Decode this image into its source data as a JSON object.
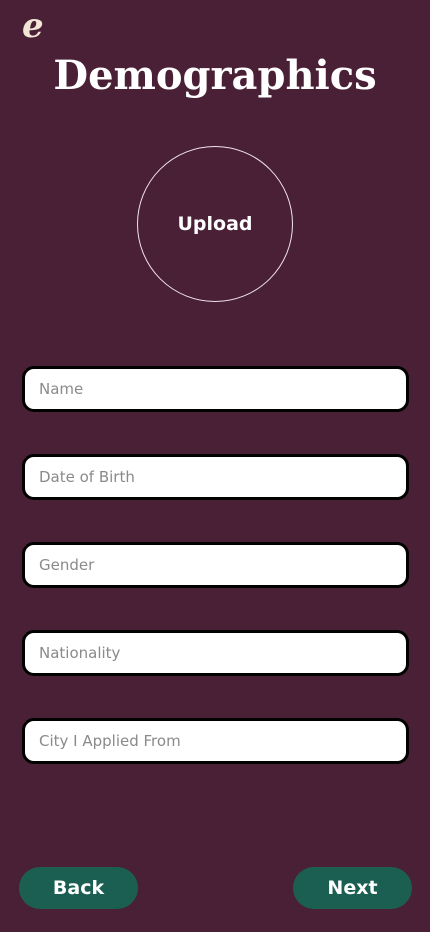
{
  "app": {
    "logo_text": "e"
  },
  "page": {
    "title": "Demographics"
  },
  "upload": {
    "label": "Upload"
  },
  "form": {
    "fields": [
      {
        "placeholder": "Name",
        "value": ""
      },
      {
        "placeholder": "Date of Birth",
        "value": ""
      },
      {
        "placeholder": "Gender",
        "value": ""
      },
      {
        "placeholder": "Nationality",
        "value": ""
      },
      {
        "placeholder": "City I Applied From",
        "value": ""
      }
    ]
  },
  "nav": {
    "back_label": "Back",
    "next_label": "Next"
  },
  "colors": {
    "background": "#4a2036",
    "button": "#1b5f52",
    "logo": "#f3e6d6"
  }
}
